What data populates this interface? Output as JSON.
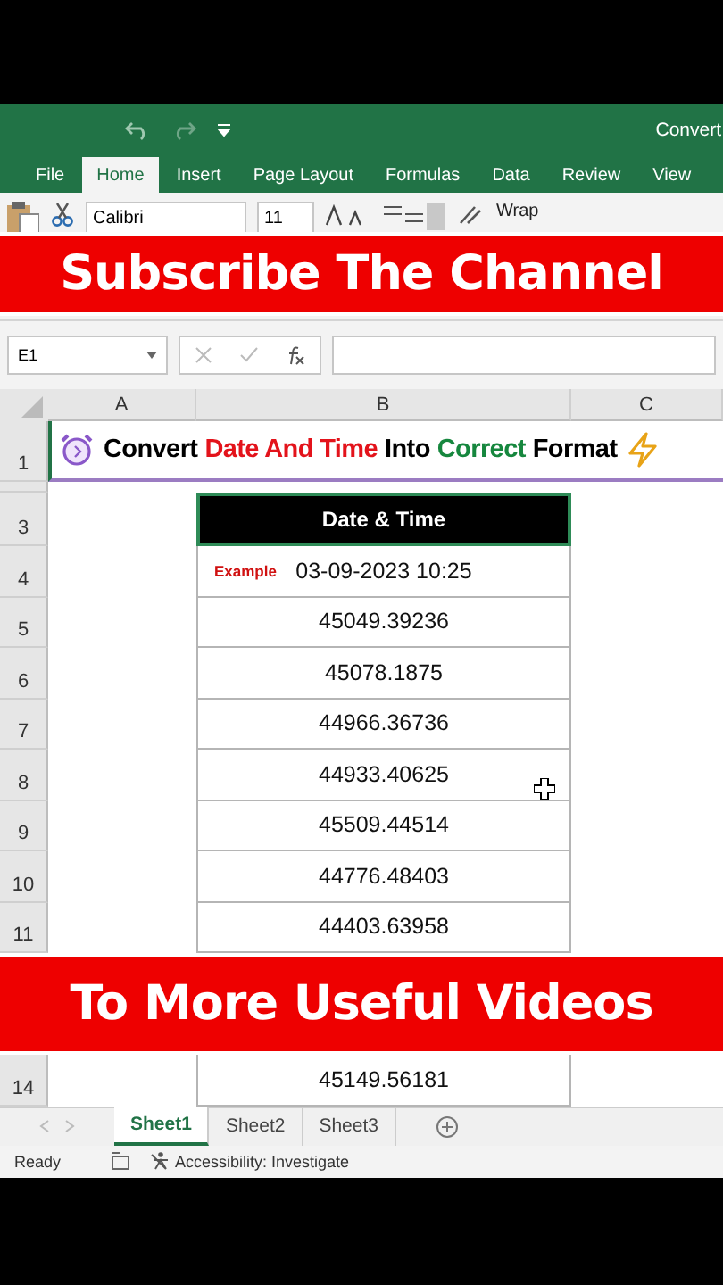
{
  "window": {
    "title": "Convert"
  },
  "ribbon_tabs": [
    {
      "label": "File",
      "selected": false
    },
    {
      "label": "Home",
      "selected": true
    },
    {
      "label": "Insert",
      "selected": false
    },
    {
      "label": "Page Layout",
      "selected": false
    },
    {
      "label": "Formulas",
      "selected": false
    },
    {
      "label": "Data",
      "selected": false
    },
    {
      "label": "Review",
      "selected": false
    },
    {
      "label": "View",
      "selected": false
    }
  ],
  "ribbon": {
    "font_name": "Calibri",
    "font_size": "11",
    "wrap_text": "Wrap"
  },
  "banners": {
    "top": "Subscribe The Channel",
    "bottom": "To More Useful Videos"
  },
  "formula_bar": {
    "name_box": "E1"
  },
  "columns": [
    "A",
    "B",
    "C"
  ],
  "title_row": {
    "row": "1",
    "parts": [
      {
        "text": "Convert",
        "color": "#000000"
      },
      {
        "text": "Date And Time",
        "color": "#e3131b"
      },
      {
        "text": "Into",
        "color": "#000000"
      },
      {
        "text": "Correct",
        "color": "#16873e"
      },
      {
        "text": "Format",
        "color": "#000000"
      }
    ]
  },
  "table": {
    "header_row": "3",
    "header": "Date & Time",
    "rows": [
      {
        "row": "4",
        "value": "03-09-2023 10:25",
        "note": "Example"
      },
      {
        "row": "5",
        "value": "45049.39236"
      },
      {
        "row": "6",
        "value": "45078.1875"
      },
      {
        "row": "7",
        "value": "44966.36736"
      },
      {
        "row": "8",
        "value": "44933.40625"
      },
      {
        "row": "9",
        "value": "45509.44514"
      },
      {
        "row": "10",
        "value": "44776.48403"
      },
      {
        "row": "11",
        "value": "44403.63958"
      }
    ],
    "rows_after_banner": [
      {
        "row": "14",
        "value": "45149.56181"
      }
    ]
  },
  "sheet_tabs": [
    {
      "label": "Sheet1",
      "selected": true
    },
    {
      "label": "Sheet2",
      "selected": false
    },
    {
      "label": "Sheet3",
      "selected": false
    }
  ],
  "status_bar": {
    "state": "Ready",
    "accessibility": "Accessibility: Investigate"
  }
}
